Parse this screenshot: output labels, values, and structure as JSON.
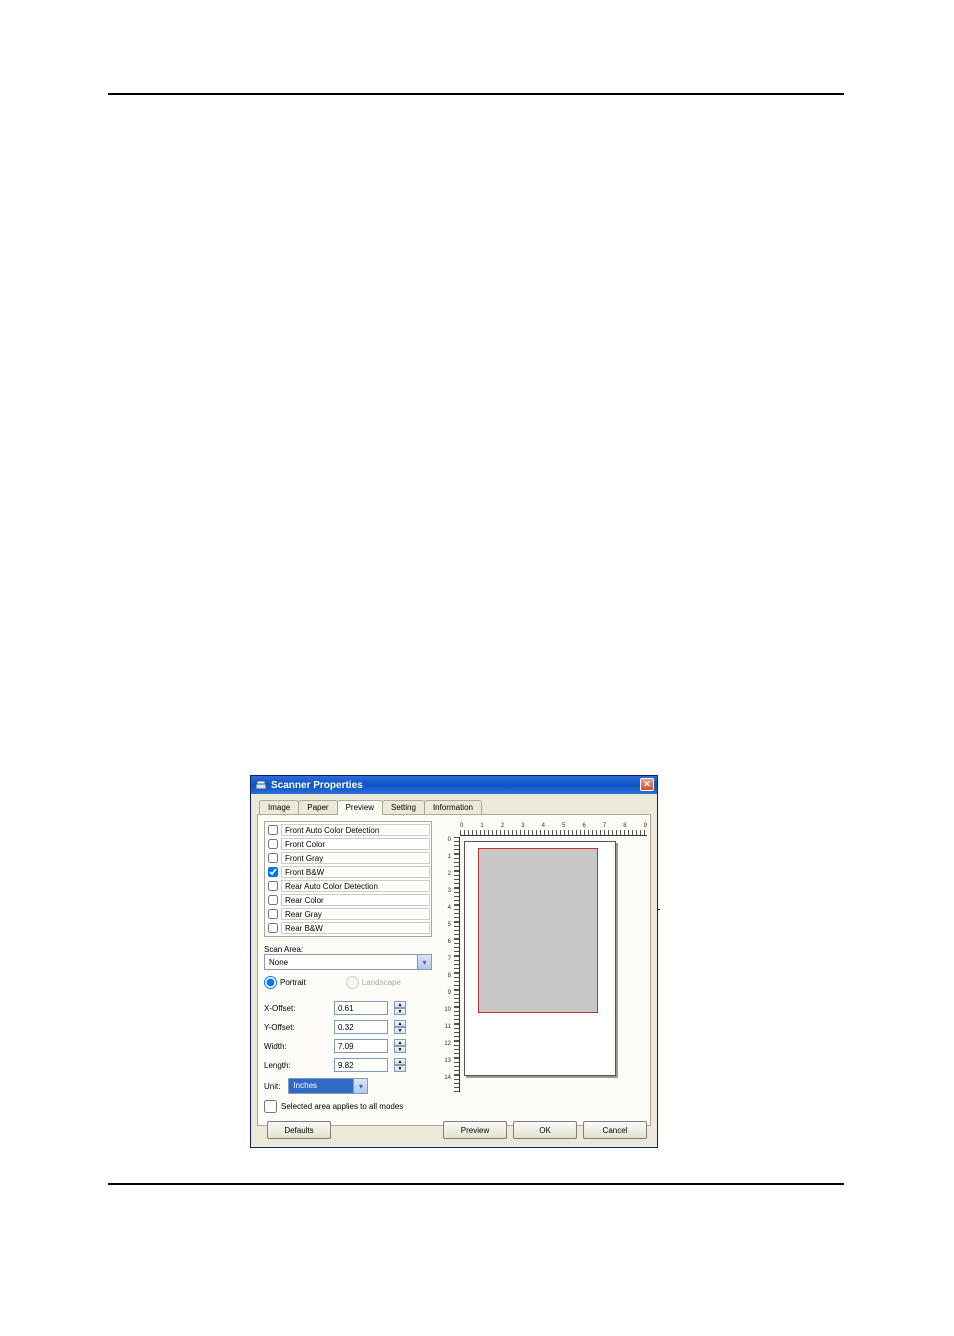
{
  "dialog": {
    "title": "Scanner Properties",
    "tabs": [
      "Image",
      "Paper",
      "Preview",
      "Setting",
      "Information"
    ],
    "active_tab": 2,
    "image_types": [
      {
        "label": "Front Auto Color Detection",
        "checked": false
      },
      {
        "label": "Front Color",
        "checked": false
      },
      {
        "label": "Front Gray",
        "checked": false
      },
      {
        "label": "Front B&W",
        "checked": true
      },
      {
        "label": "Rear Auto Color Detection",
        "checked": false
      },
      {
        "label": "Rear Color",
        "checked": false
      },
      {
        "label": "Rear Gray",
        "checked": false
      },
      {
        "label": "Rear B&W",
        "checked": false
      }
    ],
    "scan_area_label": "Scan Area:",
    "scan_area_value": "None",
    "orientation": {
      "portrait_label": "Portrait",
      "landscape_label": "Landscape",
      "selected": "portrait",
      "landscape_enabled": false
    },
    "fields": {
      "x_offset": {
        "label": "X-Offset:",
        "value": "0.61"
      },
      "y_offset": {
        "label": "Y-Offset:",
        "value": "0.32"
      },
      "width": {
        "label": "Width:",
        "value": "7.09"
      },
      "length": {
        "label": "Length:",
        "value": "9.82"
      }
    },
    "unit_label": "Unit:",
    "unit_value": "Inches",
    "selected_area_label": "Selected area applies to all modes",
    "selected_area_checked": false,
    "ruler_h": [
      "0",
      "1",
      "2",
      "3",
      "4",
      "5",
      "6",
      "7",
      "8",
      "9"
    ],
    "ruler_v": [
      "0",
      "1",
      "2",
      "3",
      "4",
      "5",
      "6",
      "7",
      "8",
      "9",
      "10",
      "11",
      "12",
      "13",
      "14"
    ],
    "buttons": {
      "defaults": "Defaults",
      "preview": "Preview",
      "ok": "OK",
      "cancel": "Cancel"
    }
  }
}
